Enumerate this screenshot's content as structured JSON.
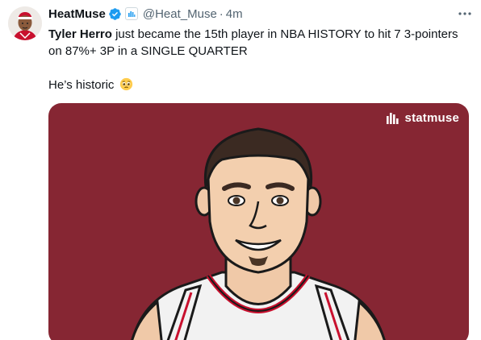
{
  "author": {
    "display_name": "HeatMuse",
    "handle": "@Heat_Muse",
    "separator": "·",
    "time": "4m"
  },
  "tweet": {
    "mention": "Tyler Herro",
    "line1_rest": " just became the 15th player in NBA HISTORY to hit 7 3-pointers",
    "line2": "on 87%+ 3P  in a SINGLE QUARTER",
    "line3": "He’s historic"
  },
  "media": {
    "brand_text": "statmuse",
    "background_color": "#862633"
  },
  "icons": {
    "verified": "verified-badge-icon",
    "affiliate": "affiliate-badge-icon",
    "more": "more-options-icon",
    "emoji": "pleading-face-emoji"
  },
  "colors": {
    "verified_blue": "#1d9bf0",
    "secondary_text": "#536471"
  }
}
